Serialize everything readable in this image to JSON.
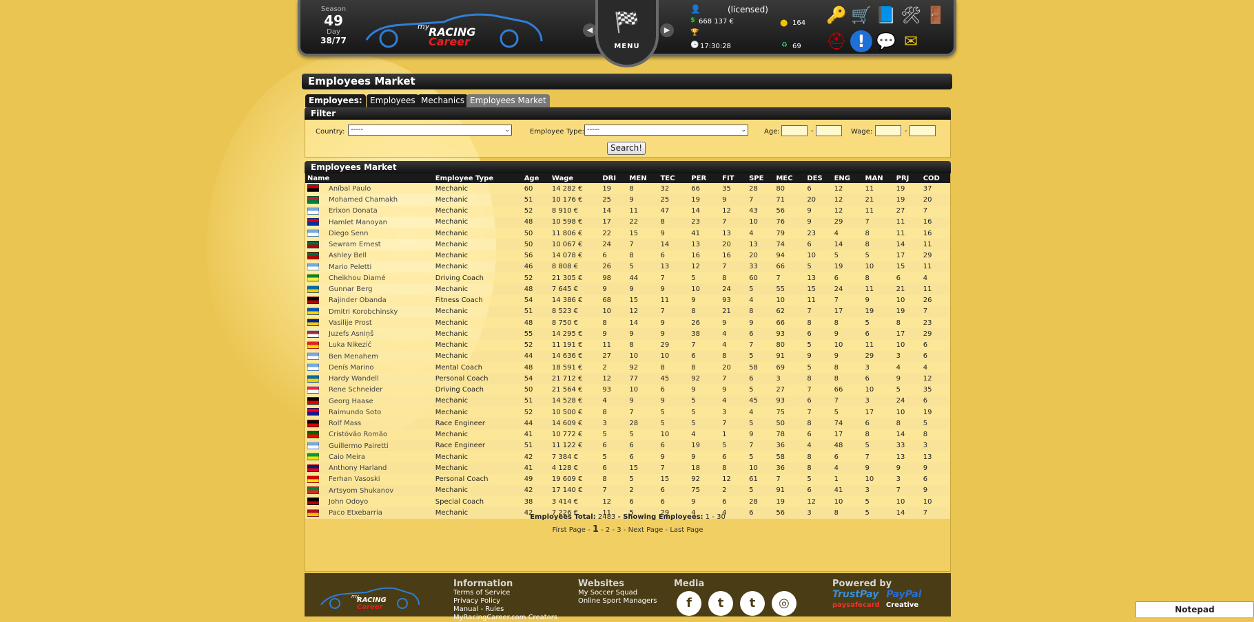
{
  "header": {
    "season_label": "Season",
    "season_value": "49",
    "day_label": "Day",
    "day_value": "38/77",
    "logo_text_top": "my",
    "logo_text_mid": "RACING",
    "logo_text_bottom": "Career",
    "menu_label": "MENU",
    "license": "(licensed)",
    "money": "668 137 €",
    "time": "17:30:28",
    "coins": "164",
    "points": "69"
  },
  "page": {
    "title": "Employees Market"
  },
  "tabs": {
    "label": "Employees:",
    "items": [
      "Employees",
      "Mechanics",
      "Employees Market"
    ]
  },
  "filter": {
    "title": "Filter",
    "country_label": "Country:",
    "country_value": "-----",
    "type_label": "Employee Type:",
    "type_value": "-----",
    "age_label": "Age:",
    "wage_label": "Wage:",
    "dash": "-",
    "search_button": "Search!"
  },
  "market": {
    "title": "Employees Market",
    "columns": [
      "Name",
      "Employee Type",
      "Age",
      "Wage",
      "DRI",
      "MEN",
      "TEC",
      "PER",
      "FIT",
      "SPE",
      "MEC",
      "DES",
      "ENG",
      "MAN",
      "PRJ",
      "COD"
    ],
    "rows": [
      {
        "flag": [
          "#c00",
          "#000"
        ],
        "name": "Aníbal Paulo",
        "type": "Mechanic",
        "age": "60",
        "wage": "14 282 €",
        "s": [
          "19",
          "8",
          "32",
          "66",
          "35",
          "28",
          "80",
          "6",
          "12",
          "11",
          "19",
          "37"
        ]
      },
      {
        "flag": [
          "#c1272d",
          "#007a3d"
        ],
        "name": "Mohamed Chamakh",
        "type": "Mechanic",
        "age": "51",
        "wage": "10 176 €",
        "s": [
          "25",
          "9",
          "25",
          "19",
          "9",
          "7",
          "71",
          "20",
          "12",
          "21",
          "19",
          "20"
        ]
      },
      {
        "flag": [
          "#75aadb",
          "#fff"
        ],
        "name": "Erixon Donata",
        "type": "Mechanic",
        "age": "52",
        "wage": "8 910 €",
        "s": [
          "14",
          "11",
          "47",
          "14",
          "12",
          "43",
          "56",
          "9",
          "12",
          "11",
          "27",
          "7"
        ]
      },
      {
        "flag": [
          "#d90012",
          "#0033a0"
        ],
        "name": "Hamlet Manoyan",
        "type": "Mechanic",
        "age": "48",
        "wage": "10 598 €",
        "s": [
          "17",
          "22",
          "8",
          "23",
          "7",
          "10",
          "76",
          "9",
          "29",
          "7",
          "11",
          "16"
        ]
      },
      {
        "flag": [
          "#75aadb",
          "#fff"
        ],
        "name": "Diego Senn",
        "type": "Mechanic",
        "age": "50",
        "wage": "11 806 €",
        "s": [
          "22",
          "15",
          "9",
          "41",
          "13",
          "4",
          "79",
          "23",
          "4",
          "8",
          "11",
          "16"
        ]
      },
      {
        "flag": [
          "#006b3f",
          "#bb0000"
        ],
        "name": "Sewram Ernest",
        "type": "Mechanic",
        "age": "50",
        "wage": "10 067 €",
        "s": [
          "24",
          "7",
          "14",
          "13",
          "20",
          "13",
          "74",
          "6",
          "14",
          "8",
          "14",
          "11"
        ]
      },
      {
        "flag": [
          "#006b3f",
          "#bb0000"
        ],
        "name": "Ashley Bell",
        "type": "Mechanic",
        "age": "56",
        "wage": "14 078 €",
        "s": [
          "6",
          "8",
          "6",
          "16",
          "16",
          "20",
          "94",
          "10",
          "5",
          "5",
          "17",
          "29"
        ]
      },
      {
        "flag": [
          "#75aadb",
          "#fff"
        ],
        "name": "Mario Peletti",
        "type": "Mechanic",
        "age": "46",
        "wage": "8 808 €",
        "s": [
          "26",
          "5",
          "13",
          "12",
          "7",
          "33",
          "66",
          "5",
          "19",
          "10",
          "15",
          "11"
        ]
      },
      {
        "flag": [
          "#00853f",
          "#fdef42"
        ],
        "name": "Cheikhou Diamé",
        "type": "Driving Coach",
        "age": "52",
        "wage": "21 305 €",
        "s": [
          "98",
          "44",
          "7",
          "5",
          "8",
          "60",
          "7",
          "13",
          "6",
          "8",
          "6",
          "4"
        ]
      },
      {
        "flag": [
          "#006aa7",
          "#fecc00"
        ],
        "name": "Gunnar Berg",
        "type": "Mechanic",
        "age": "48",
        "wage": "7 645 €",
        "s": [
          "9",
          "9",
          "9",
          "10",
          "24",
          "5",
          "55",
          "15",
          "24",
          "11",
          "21",
          "11"
        ]
      },
      {
        "flag": [
          "#000",
          "#bb0000"
        ],
        "name": "Rajinder Obanda",
        "type": "Fitness Coach",
        "age": "54",
        "wage": "14 386 €",
        "s": [
          "68",
          "15",
          "11",
          "9",
          "93",
          "4",
          "10",
          "11",
          "7",
          "9",
          "10",
          "26"
        ]
      },
      {
        "flag": [
          "#0057b7",
          "#ffd700"
        ],
        "name": "Dmitri Korobchinsky",
        "type": "Mechanic",
        "age": "51",
        "wage": "8 523 €",
        "s": [
          "10",
          "12",
          "7",
          "8",
          "21",
          "8",
          "62",
          "7",
          "17",
          "19",
          "19",
          "7"
        ]
      },
      {
        "flag": [
          "#002395",
          "#fecb00"
        ],
        "name": "Vasilije Prost",
        "type": "Mechanic",
        "age": "48",
        "wage": "8 750 €",
        "s": [
          "8",
          "14",
          "9",
          "26",
          "9",
          "9",
          "66",
          "8",
          "8",
          "5",
          "8",
          "23"
        ]
      },
      {
        "flag": [
          "#9e3039",
          "#fff"
        ],
        "name": "Juzefs Asniņš",
        "type": "Mechanic",
        "age": "55",
        "wage": "14 295 €",
        "s": [
          "9",
          "9",
          "9",
          "38",
          "4",
          "6",
          "93",
          "6",
          "9",
          "6",
          "17",
          "29"
        ]
      },
      {
        "flag": [
          "#da291c",
          "#ffd700"
        ],
        "name": "Luka Nikezić",
        "type": "Mechanic",
        "age": "52",
        "wage": "11 191 €",
        "s": [
          "11",
          "8",
          "29",
          "7",
          "4",
          "7",
          "80",
          "5",
          "10",
          "11",
          "10",
          "6"
        ]
      },
      {
        "flag": [
          "#75aadb",
          "#fff"
        ],
        "name": "Ben Menahem",
        "type": "Mechanic",
        "age": "44",
        "wage": "14 636 €",
        "s": [
          "27",
          "10",
          "10",
          "6",
          "8",
          "5",
          "91",
          "9",
          "9",
          "29",
          "3",
          "6"
        ]
      },
      {
        "flag": [
          "#75aadb",
          "#fff"
        ],
        "name": "Denís Marino",
        "type": "Mental Coach",
        "age": "48",
        "wage": "18 591 €",
        "s": [
          "2",
          "92",
          "8",
          "8",
          "20",
          "58",
          "69",
          "5",
          "8",
          "3",
          "4",
          "4"
        ]
      },
      {
        "flag": [
          "#006aa7",
          "#fecc00"
        ],
        "name": "Hardy Wandell",
        "type": "Personal Coach",
        "age": "54",
        "wage": "21 712 €",
        "s": [
          "12",
          "77",
          "45",
          "92",
          "7",
          "6",
          "3",
          "8",
          "8",
          "6",
          "9",
          "12"
        ]
      },
      {
        "flag": [
          "#ed2939",
          "#fff"
        ],
        "name": "Rene Schneider",
        "type": "Driving Coach",
        "age": "50",
        "wage": "21 564 €",
        "s": [
          "93",
          "10",
          "6",
          "9",
          "9",
          "5",
          "27",
          "7",
          "66",
          "10",
          "5",
          "35"
        ]
      },
      {
        "flag": [
          "#000",
          "#dd0000"
        ],
        "name": "Georg Haase",
        "type": "Mechanic",
        "age": "51",
        "wage": "14 528 €",
        "s": [
          "4",
          "9",
          "9",
          "5",
          "4",
          "45",
          "93",
          "6",
          "7",
          "3",
          "24",
          "6"
        ]
      },
      {
        "flag": [
          "#ff0000",
          "#171796"
        ],
        "name": "Raimundo Soto",
        "type": "Mechanic",
        "age": "52",
        "wage": "10 500 €",
        "s": [
          "8",
          "7",
          "5",
          "5",
          "3",
          "4",
          "75",
          "7",
          "5",
          "17",
          "10",
          "19"
        ]
      },
      {
        "flag": [
          "#000",
          "#dd0000"
        ],
        "name": "Rolf Mass",
        "type": "Race Engineer",
        "age": "44",
        "wage": "14 609 €",
        "s": [
          "3",
          "28",
          "5",
          "5",
          "7",
          "5",
          "50",
          "8",
          "74",
          "6",
          "8",
          "5"
        ]
      },
      {
        "flag": [
          "#006600",
          "#ff0000"
        ],
        "name": "Cristóvão Romão",
        "type": "Mechanic",
        "age": "41",
        "wage": "10 772 €",
        "s": [
          "5",
          "5",
          "10",
          "4",
          "1",
          "9",
          "78",
          "6",
          "17",
          "8",
          "14",
          "8"
        ]
      },
      {
        "flag": [
          "#75aadb",
          "#fff"
        ],
        "name": "Guillermo Pairetti",
        "type": "Race Engineer",
        "age": "51",
        "wage": "11 122 €",
        "s": [
          "6",
          "6",
          "6",
          "19",
          "5",
          "7",
          "36",
          "4",
          "48",
          "5",
          "33",
          "3"
        ]
      },
      {
        "flag": [
          "#009c3b",
          "#ffdf00"
        ],
        "name": "Caio Meira",
        "type": "Mechanic",
        "age": "42",
        "wage": "7 384 €",
        "s": [
          "5",
          "6",
          "9",
          "9",
          "6",
          "5",
          "58",
          "8",
          "6",
          "7",
          "13",
          "13"
        ]
      },
      {
        "flag": [
          "#012169",
          "#e4002b"
        ],
        "name": "Anthony Harland",
        "type": "Mechanic",
        "age": "41",
        "wage": "4 128 €",
        "s": [
          "6",
          "15",
          "7",
          "18",
          "8",
          "10",
          "36",
          "8",
          "4",
          "9",
          "9",
          "9"
        ]
      },
      {
        "flag": [
          "#d20000",
          "#ffe600"
        ],
        "name": "Ferhan Vasoski",
        "type": "Personal Coach",
        "age": "49",
        "wage": "19 609 €",
        "s": [
          "8",
          "5",
          "15",
          "92",
          "12",
          "61",
          "7",
          "5",
          "1",
          "10",
          "3",
          "6"
        ]
      },
      {
        "flag": [
          "#00843d",
          "#d52b1e"
        ],
        "name": "Artsyom Shukanov",
        "type": "Mechanic",
        "age": "42",
        "wage": "17 140 €",
        "s": [
          "7",
          "2",
          "6",
          "75",
          "2",
          "5",
          "91",
          "6",
          "41",
          "3",
          "7",
          "9"
        ]
      },
      {
        "flag": [
          "#000",
          "#bb0000"
        ],
        "name": "John Odoyo",
        "type": "Special Coach",
        "age": "38",
        "wage": "3 414 €",
        "s": [
          "12",
          "6",
          "6",
          "9",
          "6",
          "28",
          "19",
          "12",
          "10",
          "5",
          "10",
          "10"
        ]
      },
      {
        "flag": [
          "#aa151b",
          "#f1bf00"
        ],
        "name": "Paco Etxebarria",
        "type": "Mechanic",
        "age": "42",
        "wage": "7 226 €",
        "s": [
          "11",
          "5",
          "29",
          "4",
          "4",
          "6",
          "56",
          "3",
          "8",
          "5",
          "14",
          "7"
        ]
      }
    ],
    "totals_label": "Employees Total:",
    "totals_value": "2483",
    "showing_label": "- Showing Employees:",
    "showing_value": "1 - 30",
    "pager": {
      "first": "First Page",
      "current": "1",
      "p2": "2",
      "p3": "3",
      "next": "Next Page",
      "last": "Last Page",
      "sep": "-"
    }
  },
  "footer": {
    "info_title": "Information",
    "info_links": [
      "Terms of Service",
      "Privacy Policy",
      "Manual - Rules",
      "MyRacingCareer.com Creators"
    ],
    "web_title": "Websites",
    "web_links": [
      "My Soccer Squad",
      "Online Sport Managers"
    ],
    "media_title": "Media",
    "media_icons": [
      "facebook-icon",
      "twitter-icon",
      "tumblr-icon",
      "instagram-icon"
    ],
    "powered_title": "Powered by",
    "powered_brands": [
      "TrustPay",
      "PayPal",
      "paysafecard",
      "Creative"
    ]
  },
  "notepad": {
    "label": "Notepad"
  }
}
